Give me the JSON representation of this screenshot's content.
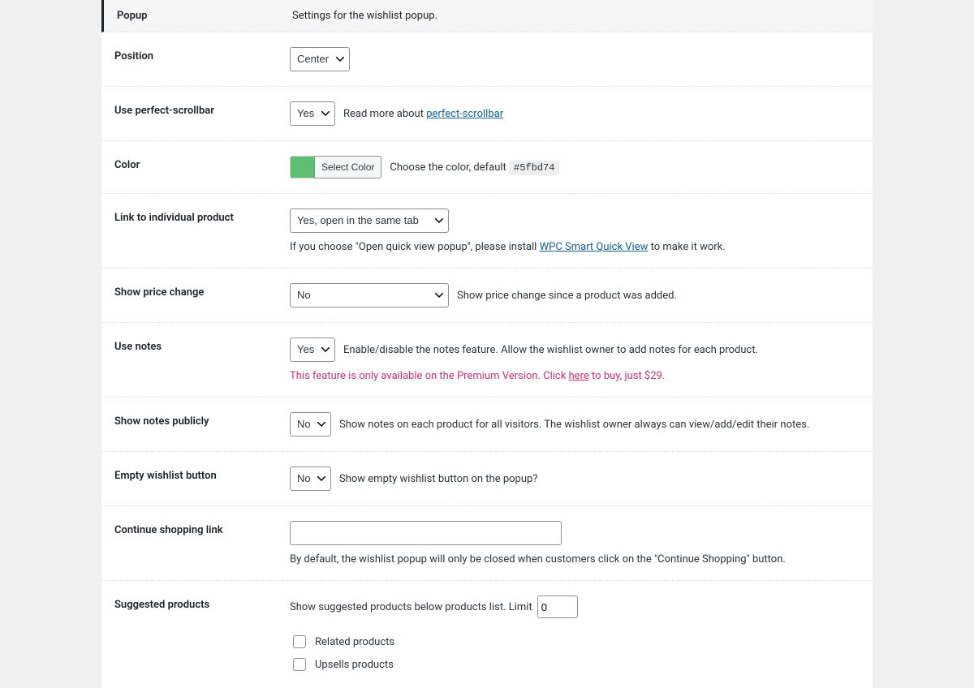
{
  "header": {
    "title": "Popup",
    "desc": "Settings for the wishlist popup."
  },
  "position": {
    "label": "Position",
    "value": "Center"
  },
  "perfect_scrollbar": {
    "label": "Use perfect-scrollbar",
    "value": "Yes",
    "desc_prefix": "Read more about ",
    "link_text": "perfect-scrollbar"
  },
  "color": {
    "label": "Color",
    "button": "Select Color",
    "swatch": "#5fbd74",
    "desc_prefix": "Choose the color, default ",
    "default_code": "#5fbd74"
  },
  "link_product": {
    "label": "Link to individual product",
    "value": "Yes, open in the same tab",
    "note_prefix": "If you choose \"Open quick view popup\", please install ",
    "note_link": "WPC Smart Quick View",
    "note_suffix": " to make it work."
  },
  "price_change": {
    "label": "Show price change",
    "value": "No",
    "desc": "Show price change since a product was added."
  },
  "use_notes": {
    "label": "Use notes",
    "value": "Yes",
    "desc": "Enable/disable the notes feature. Allow the wishlist owner to add notes for each product.",
    "premium_prefix": "This feature is only available on the Premium Version. Click ",
    "premium_link": "here",
    "premium_suffix": " to buy, just $29."
  },
  "show_notes_publicly": {
    "label": "Show notes publicly",
    "value": "No",
    "desc": "Show notes on each product for all visitors. The wishlist owner always can view/add/edit their notes."
  },
  "empty_wishlist": {
    "label": "Empty wishlist button",
    "value": "No",
    "desc": "Show empty wishlist button on the popup?"
  },
  "continue_shopping": {
    "label": "Continue shopping link",
    "value": "",
    "desc": "By default, the wishlist popup will only be closed when customers click on the \"Continue Shopping\" button."
  },
  "suggested": {
    "label": "Suggested products",
    "desc_prefix": "Show suggested products below products list. Limit",
    "limit": "0",
    "check_related": "Related products",
    "check_upsells": "Upsells products"
  }
}
